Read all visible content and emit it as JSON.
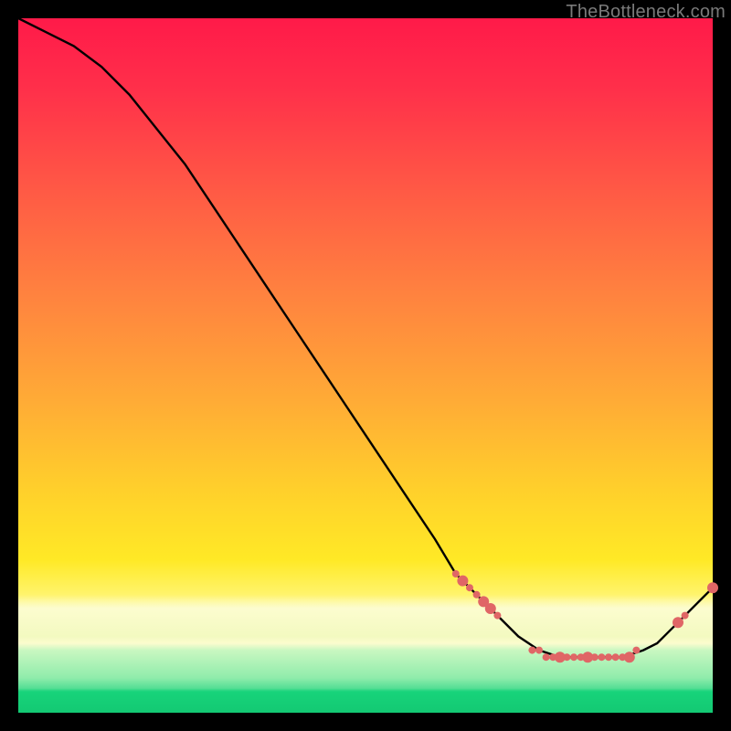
{
  "watermark": "TheBottleneck.com",
  "chart_data": {
    "type": "line",
    "title": "",
    "xlabel": "",
    "ylabel": "",
    "xlim": [
      0,
      100
    ],
    "ylim": [
      0,
      100
    ],
    "grid": false,
    "legend": false,
    "series": [
      {
        "name": "bottleneck-curve",
        "stroke": "#000000",
        "x": [
          0,
          4,
          8,
          12,
          16,
          20,
          24,
          28,
          32,
          36,
          40,
          44,
          48,
          52,
          56,
          60,
          63,
          64,
          65,
          67,
          69,
          72,
          75,
          78,
          81,
          84,
          87,
          90,
          92,
          94,
          96,
          98,
          100
        ],
        "values": [
          100,
          98,
          96,
          93,
          89,
          84,
          79,
          73,
          67,
          61,
          55,
          49,
          43,
          37,
          31,
          25,
          20,
          19,
          18,
          16,
          14,
          11,
          9,
          8,
          8,
          8,
          8,
          9,
          10,
          12,
          14,
          16,
          18
        ]
      }
    ],
    "markers": {
      "name": "highlight-dots",
      "color": "#e06666",
      "radius_small": 4,
      "radius_large": 6,
      "points": [
        {
          "x": 63,
          "y": 20,
          "r": "small"
        },
        {
          "x": 64,
          "y": 19,
          "r": "large"
        },
        {
          "x": 65,
          "y": 18,
          "r": "small"
        },
        {
          "x": 66,
          "y": 17,
          "r": "small"
        },
        {
          "x": 67,
          "y": 16,
          "r": "large"
        },
        {
          "x": 68,
          "y": 15,
          "r": "large"
        },
        {
          "x": 69,
          "y": 14,
          "r": "small"
        },
        {
          "x": 74,
          "y": 9,
          "r": "small"
        },
        {
          "x": 75,
          "y": 9,
          "r": "small"
        },
        {
          "x": 76,
          "y": 8,
          "r": "small"
        },
        {
          "x": 77,
          "y": 8,
          "r": "small"
        },
        {
          "x": 78,
          "y": 8,
          "r": "large"
        },
        {
          "x": 79,
          "y": 8,
          "r": "small"
        },
        {
          "x": 80,
          "y": 8,
          "r": "small"
        },
        {
          "x": 81,
          "y": 8,
          "r": "small"
        },
        {
          "x": 82,
          "y": 8,
          "r": "large"
        },
        {
          "x": 83,
          "y": 8,
          "r": "small"
        },
        {
          "x": 84,
          "y": 8,
          "r": "small"
        },
        {
          "x": 85,
          "y": 8,
          "r": "small"
        },
        {
          "x": 86,
          "y": 8,
          "r": "small"
        },
        {
          "x": 87,
          "y": 8,
          "r": "small"
        },
        {
          "x": 88,
          "y": 8,
          "r": "large"
        },
        {
          "x": 89,
          "y": 9,
          "r": "small"
        },
        {
          "x": 95,
          "y": 13,
          "r": "large"
        },
        {
          "x": 96,
          "y": 14,
          "r": "small"
        },
        {
          "x": 100,
          "y": 18,
          "r": "large"
        }
      ]
    }
  }
}
